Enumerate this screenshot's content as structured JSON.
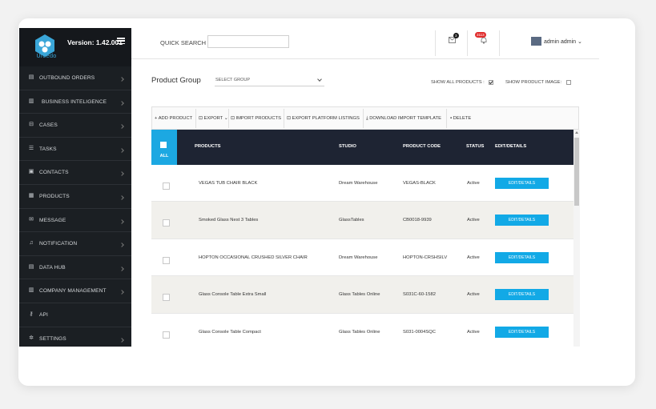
{
  "app": {
    "logo_text": "Ufoedo",
    "version": "Version: 1.42.001"
  },
  "sidebar": {
    "items": [
      {
        "label": "OUTBOUND ORDERS",
        "icon": "document-icon"
      },
      {
        "label": "BUSINESS INTELIGENCE",
        "icon": "chart-icon"
      },
      {
        "label": "CASES",
        "icon": "inbox-icon"
      },
      {
        "label": "TASKS",
        "icon": "list-icon"
      },
      {
        "label": "CONTACTS",
        "icon": "contact-icon"
      },
      {
        "label": "PRODUCTS",
        "icon": "box-icon"
      },
      {
        "label": "MESSAGE",
        "icon": "envelope-icon"
      },
      {
        "label": "NOTIFICATION",
        "icon": "bell-icon"
      },
      {
        "label": "DATA HUB",
        "icon": "database-icon"
      },
      {
        "label": "COMPANY MANAGEMENT",
        "icon": "building-icon"
      },
      {
        "label": "API",
        "icon": "key-icon"
      },
      {
        "label": "SETTINGS",
        "icon": "gear-icon"
      }
    ]
  },
  "header": {
    "quick_search_label": "QUICK SEARCH :",
    "quick_search_value": "",
    "mail_count": "3",
    "notif_count": "3113",
    "user": "admin admin"
  },
  "filters": {
    "product_group_label": "Product Group",
    "select_group": "SELECT GROUP",
    "show_all_products": "SHOW ALL PRODUCTS :",
    "show_product_image": "SHOW PRODUCT IMAGE:"
  },
  "toolbar": {
    "add": "ADD PRODUCT",
    "export": "EXPORT",
    "import": "IMPORT PRODUCTS",
    "export_platform": "EXPORT PLATFORM LISTINGS",
    "download_template": "DOWNLOAD IMPORT TEMPLATE",
    "delete": "DELETE"
  },
  "table": {
    "all_label": "ALL",
    "headers": {
      "products": "PRODUCTS",
      "studio": "STUDIO",
      "code": "PRODUCT CODE",
      "status": "STATUS",
      "edit": "EDIT/DETAILS"
    },
    "edit_label": "EDIT/DETAILS",
    "rows": [
      {
        "product": "VEGAS TUB CHAIR BLACK",
        "studio": "Dream Warehouse",
        "code": "VEGAS-BLACK",
        "status": "Active"
      },
      {
        "product": "Smoked Glass Nest 3 Tables",
        "studio": "GlassTables",
        "code": "CB0018-9939",
        "status": "Active"
      },
      {
        "product": "HOPTON OCCASIONAL CRUSHED SILVER CHAIR",
        "studio": "Dream Warehouse",
        "code": "HOPTON-CRSHSILV",
        "status": "Active"
      },
      {
        "product": "Glass Console Table Extra Small",
        "studio": "Glass Tables Online",
        "code": "S031C-60-1582",
        "status": "Active"
      },
      {
        "product": "Glass Console Table Compact",
        "studio": "Glass Tables Online",
        "code": "S031-0004SQC",
        "status": "Active"
      }
    ]
  }
}
